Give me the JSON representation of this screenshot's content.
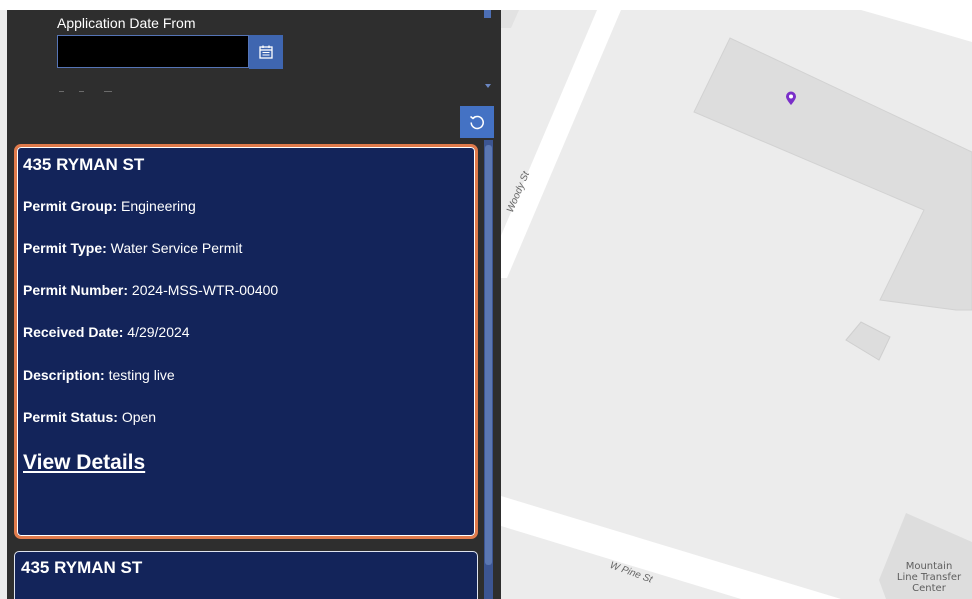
{
  "filters": {
    "application_date_from_label": "Application Date From",
    "application_date_from_value": ""
  },
  "results": [
    {
      "address": "435 RYMAN ST",
      "fields": [
        {
          "label": "Permit Group:",
          "value": "Engineering"
        },
        {
          "label": "Permit Type:",
          "value": "Water Service Permit"
        },
        {
          "label": "Permit Number:",
          "value": "2024-MSS-WTR-00400"
        },
        {
          "label": "Received Date:",
          "value": "4/29/2024"
        },
        {
          "label": "Description:",
          "value": "testing live"
        },
        {
          "label": "Permit Status:",
          "value": "Open"
        }
      ],
      "link_label": "View Details",
      "selected": true
    },
    {
      "address": "435 RYMAN ST"
    }
  ],
  "map": {
    "streets": [
      "Woody St",
      "W Pine St"
    ],
    "poi": [
      "Mountain",
      "Line Transfer",
      "Center"
    ],
    "marker_color": "#7a2fc9"
  },
  "icons": {
    "calendar": "calendar-icon",
    "reset": "reset-icon",
    "marker": "map-pin-icon"
  },
  "colors": {
    "card_background": "#13245a",
    "selected_border": "#e07a4b",
    "button_blue": "#4472c4",
    "panel_background": "#2e2e2e"
  }
}
